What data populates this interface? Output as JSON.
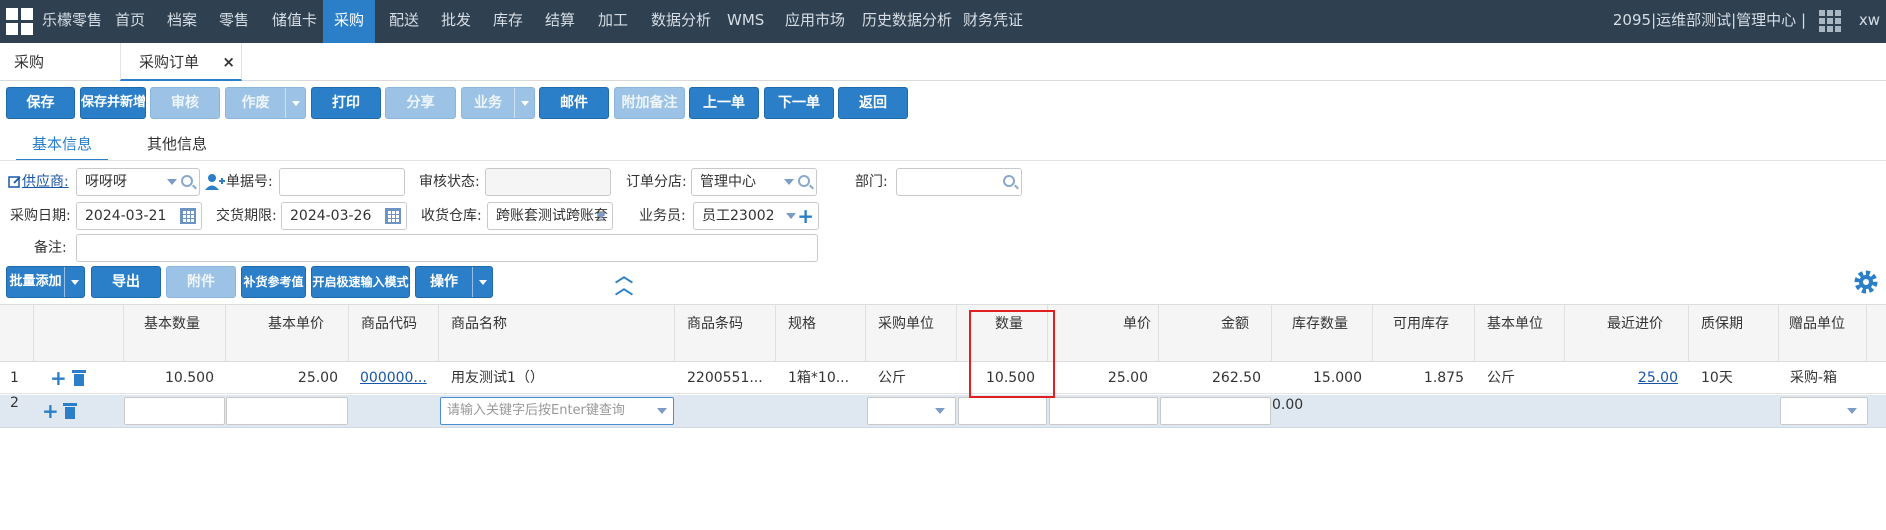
{
  "topnav": {
    "brand": "乐檬零售",
    "items": [
      "首页",
      "档案",
      "零售",
      "储值卡",
      "采购",
      "配送",
      "批发",
      "库存",
      "结算",
      "加工",
      "数据分析",
      "WMS",
      "应用市场",
      "历史数据分析",
      "财务凭证"
    ],
    "active": "采购",
    "userinfo": "2095|运维部测试|管理中心 |",
    "user_short": "xw"
  },
  "page_tabs": [
    "采购",
    "采购订单"
  ],
  "toolbar": [
    "保存",
    "保存并新增",
    "审核",
    "作废",
    "打印",
    "分享",
    "业务",
    "邮件",
    "附加备注",
    "上一单",
    "下一单",
    "返回"
  ],
  "sub_tabs": [
    "基本信息",
    "其他信息"
  ],
  "form": {
    "supplier_label": "供应商:",
    "supplier_value": "呀呀呀",
    "doc_no_label": "单据号:",
    "doc_no_value": "",
    "audit_label": "审核状态:",
    "audit_value": "",
    "branch_label": "订单分店:",
    "branch_value": "管理中心",
    "dept_label": "部门:",
    "dept_value": "",
    "purchase_date_label": "采购日期:",
    "purchase_date_value": "2024-03-21",
    "delivery_label": "交货期限:",
    "delivery_value": "2024-03-26",
    "warehouse_label": "收货仓库:",
    "warehouse_value": "跨账套测试跨账套",
    "salesman_label": "业务员:",
    "salesman_value": "员工23002",
    "remark_label": "备注:",
    "remark_value": ""
  },
  "grid_toolbar": [
    "批量添加",
    "导出",
    "附件",
    "补货参考值",
    "开启极速输入模式",
    "操作"
  ],
  "table": {
    "headers": [
      "基本数量",
      "基本单价",
      "商品代码",
      "商品名称",
      "商品条码",
      "规格",
      "采购单位",
      "数量",
      "单价",
      "金额",
      "库存数量",
      "可用库存",
      "基本单位",
      "最近进价",
      "质保期",
      "赠品单位"
    ],
    "rows": [
      {
        "no": "1",
        "basic_qty": "10.500",
        "basic_price": "25.00",
        "code": "000000...",
        "name": "用友测试1（）",
        "barcode": "2200551...",
        "spec": "1箱*10...",
        "unit": "公斤",
        "qty": "10.500",
        "price": "25.00",
        "amount": "262.50",
        "stock": "15.000",
        "available": "1.875",
        "base_unit": "公斤",
        "last_price": "25.00",
        "warranty": "10天",
        "gift_unit": "采购-箱"
      }
    ],
    "new_row": {
      "no": "2",
      "name_placeholder": "请输入关键字后按Enter键查询",
      "amount": "0.00"
    }
  },
  "colors": {
    "nav_bg": "#2f4050",
    "accent": "#2b7fc9",
    "highlight": "#e02020"
  }
}
